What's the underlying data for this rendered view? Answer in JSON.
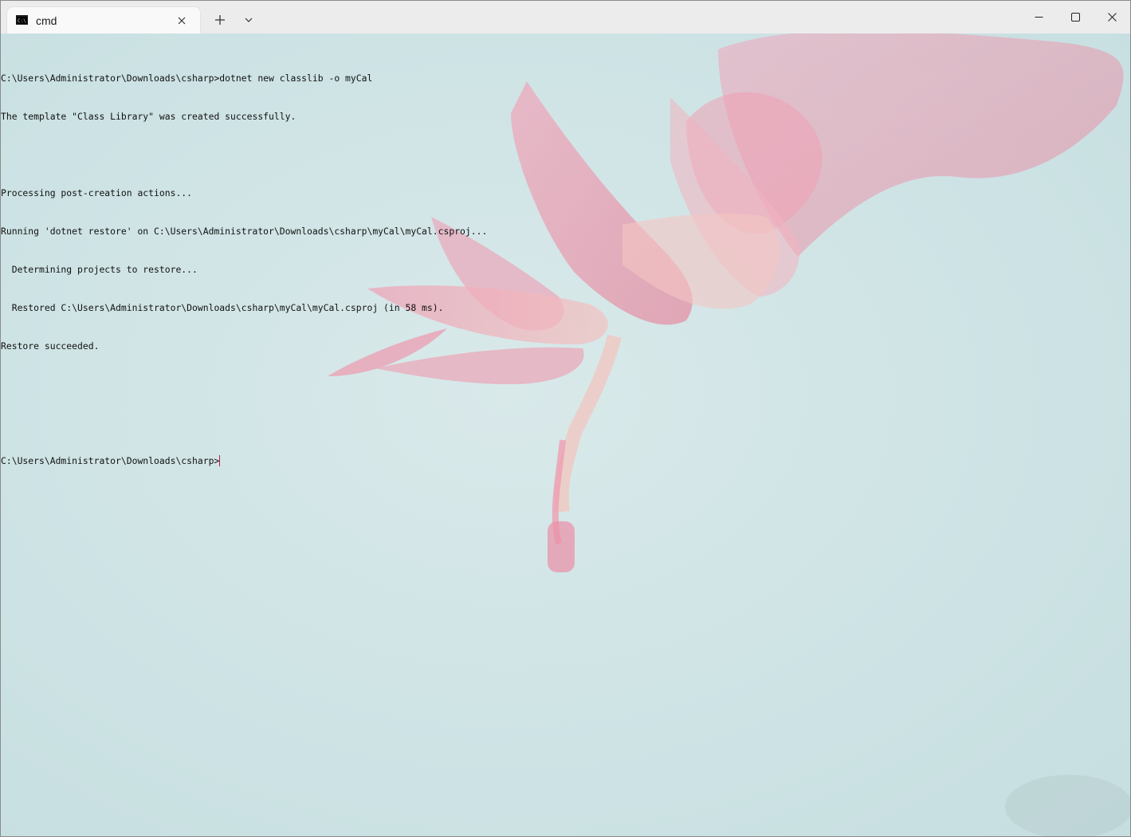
{
  "tab": {
    "title": "cmd",
    "icon": "cmd-prompt-icon"
  },
  "titlebar": {
    "new_tab_icon": "plus-icon",
    "dropdown_icon": "chevron-down-icon",
    "minimize_icon": "minimize-icon",
    "maximize_icon": "maximize-icon",
    "close_icon": "close-icon"
  },
  "terminal": {
    "lines": [
      "C:\\Users\\Administrator\\Downloads\\csharp>dotnet new classlib -o myCal",
      "The template \"Class Library\" was created successfully.",
      "",
      "Processing post-creation actions...",
      "Running 'dotnet restore' on C:\\Users\\Administrator\\Downloads\\csharp\\myCal\\myCal.csproj...",
      "  Determining projects to restore...",
      "  Restored C:\\Users\\Administrator\\Downloads\\csharp\\myCal\\myCal.csproj (in 58 ms).",
      "Restore succeeded.",
      "",
      "",
      "C:\\Users\\Administrator\\Downloads\\csharp>"
    ],
    "cursor_color": "#c2185b",
    "background_color": "#cfe3e5",
    "text_color": "#111111"
  }
}
